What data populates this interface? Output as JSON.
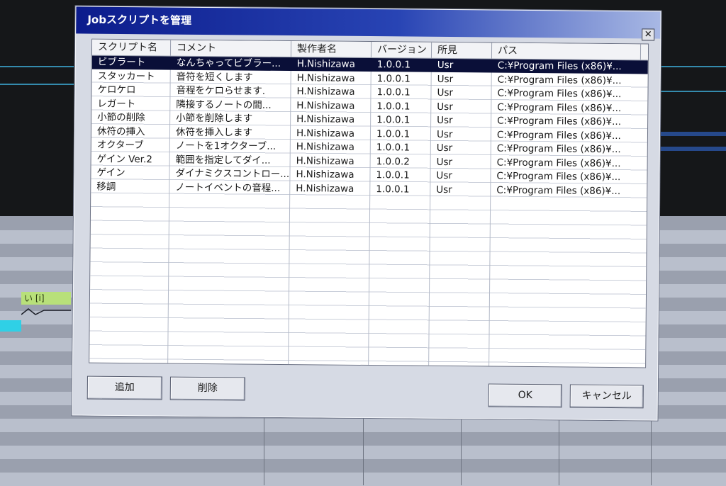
{
  "dialog": {
    "title": "Jobスクリプトを管理",
    "close_glyph": "✕"
  },
  "columns": [
    "スクリプト名",
    "コメント",
    "製作者名",
    "バージョン",
    "所見",
    "パス"
  ],
  "rows": [
    {
      "name": "ビブラート",
      "comment": "なんちゃってビブラー...",
      "author": "H.Nishizawa",
      "version": "1.0.0.1",
      "loc": "Usr",
      "path": "C:¥Program Files (x86)¥...",
      "selected": true
    },
    {
      "name": "スタッカート",
      "comment": "音符を短くします",
      "author": "H.Nishizawa",
      "version": "1.0.0.1",
      "loc": "Usr",
      "path": "C:¥Program Files (x86)¥..."
    },
    {
      "name": "ケロケロ",
      "comment": "音程をケロらせます.",
      "author": "H.Nishizawa",
      "version": "1.0.0.1",
      "loc": "Usr",
      "path": "C:¥Program Files (x86)¥..."
    },
    {
      "name": "レガート",
      "comment": "隣接するノートの間...",
      "author": "H.Nishizawa",
      "version": "1.0.0.1",
      "loc": "Usr",
      "path": "C:¥Program Files (x86)¥..."
    },
    {
      "name": "小節の削除",
      "comment": "小節を削除します",
      "author": "H.Nishizawa",
      "version": "1.0.0.1",
      "loc": "Usr",
      "path": "C:¥Program Files (x86)¥..."
    },
    {
      "name": "休符の挿入",
      "comment": "休符を挿入します",
      "author": "H.Nishizawa",
      "version": "1.0.0.1",
      "loc": "Usr",
      "path": "C:¥Program Files (x86)¥..."
    },
    {
      "name": "オクターブ",
      "comment": "ノートを1オクターブ...",
      "author": "H.Nishizawa",
      "version": "1.0.0.1",
      "loc": "Usr",
      "path": "C:¥Program Files (x86)¥..."
    },
    {
      "name": "ゲイン Ver.2",
      "comment": "範囲を指定してダイ...",
      "author": "H.Nishizawa",
      "version": "1.0.0.2",
      "loc": "Usr",
      "path": "C:¥Program Files (x86)¥..."
    },
    {
      "name": "ゲイン",
      "comment": "ダイナミクスコントロー...",
      "author": "H.Nishizawa",
      "version": "1.0.0.1",
      "loc": "Usr",
      "path": "C:¥Program Files (x86)¥..."
    },
    {
      "name": "移調",
      "comment": "ノートイベントの音程...",
      "author": "H.Nishizawa",
      "version": "1.0.0.1",
      "loc": "Usr",
      "path": "C:¥Program Files (x86)¥..."
    }
  ],
  "buttons": {
    "add": "追加",
    "delete": "削除",
    "ok": "OK",
    "cancel": "キャンセル"
  },
  "background": {
    "lyric_note": "い [i]"
  },
  "colors": {
    "title_start": "#0c1c8c",
    "selection": "#0a0f38",
    "lyric_note": "#b8e07a",
    "cyan_note": "#2fd0e6"
  }
}
